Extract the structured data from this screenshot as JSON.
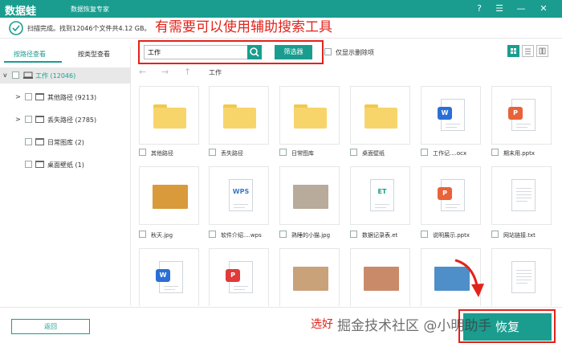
{
  "app": {
    "logo": "数据蛙",
    "subtitle": "数据恢复专家"
  },
  "window_buttons": [
    "?",
    "☰",
    "—",
    "✕"
  ],
  "status": {
    "text": "扫描完成。找到12046个文件共4.12 GB。"
  },
  "annotation": "有需要可以使用辅助搜索工具",
  "sidebar": {
    "tabs": [
      {
        "label": "按路径查看",
        "active": true
      },
      {
        "label": "按类型查看",
        "active": false
      }
    ],
    "tree": [
      {
        "label": "工作 (12046)",
        "expander": "v",
        "selected": true
      },
      {
        "label": "其他路径 (9213)",
        "expander": ">",
        "selected": false
      },
      {
        "label": "丢失路径 (2785)",
        "expander": ">",
        "selected": false
      },
      {
        "label": "日常图库 (2)",
        "expander": "",
        "selected": false
      },
      {
        "label": "桌面壁纸 (1)",
        "expander": "",
        "selected": false
      }
    ]
  },
  "toolbar": {
    "search_value": "工作",
    "filter_label": "筛选器",
    "deleted_only_label": "仅显示删除项"
  },
  "nav": {
    "back": "←",
    "forward": "→",
    "up": "↑",
    "path": "工作"
  },
  "files": [
    {
      "name": "其他路径",
      "kind": "folder"
    },
    {
      "name": "丢失路径",
      "kind": "folder"
    },
    {
      "name": "日常图库",
      "kind": "folder"
    },
    {
      "name": "桌面壁纸",
      "kind": "folder"
    },
    {
      "name": "工作记....ocx",
      "kind": "doc",
      "badge": "W",
      "color": "#2b6fd6"
    },
    {
      "name": "期末用.pptx",
      "kind": "doc",
      "badge": "P",
      "color": "#e8633a"
    },
    {
      "name": "秋天.jpg",
      "kind": "photo",
      "color": "#d99a3c"
    },
    {
      "name": "软件介绍....wps",
      "kind": "doc",
      "badge": "WPS",
      "color": "#3b79c9"
    },
    {
      "name": "熟睡的小猫.jpg",
      "kind": "photo",
      "color": "#b8ab9c"
    },
    {
      "name": "数据记录表.et",
      "kind": "doc",
      "badge": "ET",
      "color": "#1a9d8f"
    },
    {
      "name": "说明展示.pptx",
      "kind": "doc",
      "badge": "P",
      "color": "#e8633a"
    },
    {
      "name": "网站链接.txt",
      "kind": "txt"
    },
    {
      "name": "",
      "kind": "doc",
      "badge": "W",
      "color": "#2b6fd6"
    },
    {
      "name": "",
      "kind": "doc",
      "badge": "P",
      "color": "#e03a3a"
    },
    {
      "name": "",
      "kind": "photo",
      "color": "#c9a27a"
    },
    {
      "name": "",
      "kind": "photo",
      "color": "#c98a6a"
    },
    {
      "name": "",
      "kind": "photo",
      "color": "#4f8fc9"
    },
    {
      "name": "",
      "kind": "txt"
    }
  ],
  "footer": {
    "back_label": "返回",
    "note": "选好",
    "watermark": "掘金技术社区 @小明助手",
    "recover_label": "恢复"
  }
}
